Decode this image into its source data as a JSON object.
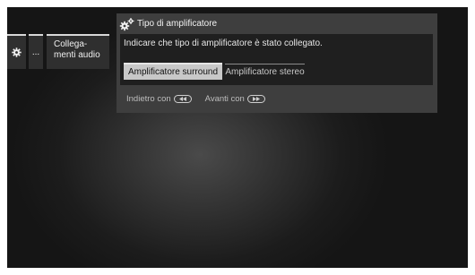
{
  "breadcrumb": {
    "gear_icon": "gear-icon",
    "ellipsis": "...",
    "section": "Collega-\nmenti audio"
  },
  "dialog": {
    "title": "Tipo di amplificatore",
    "title_icon": "gears-icon",
    "instruction": "Indicare che tipo di amplificatore è stato collegato.",
    "options": [
      {
        "label": "Amplificatore surround",
        "selected": true
      },
      {
        "label": "Amplificatore stereo",
        "selected": false
      }
    ]
  },
  "footer": {
    "back_label": "Indietro con",
    "back_key_icon": "rewind-key-icon",
    "forward_label": "Avanti con",
    "forward_key_icon": "fast-forward-key-icon"
  },
  "colors": {
    "panel_bg": "#3e3e3e",
    "content_bg": "#1f1f1f",
    "selected_bg": "#c8c8c8"
  }
}
